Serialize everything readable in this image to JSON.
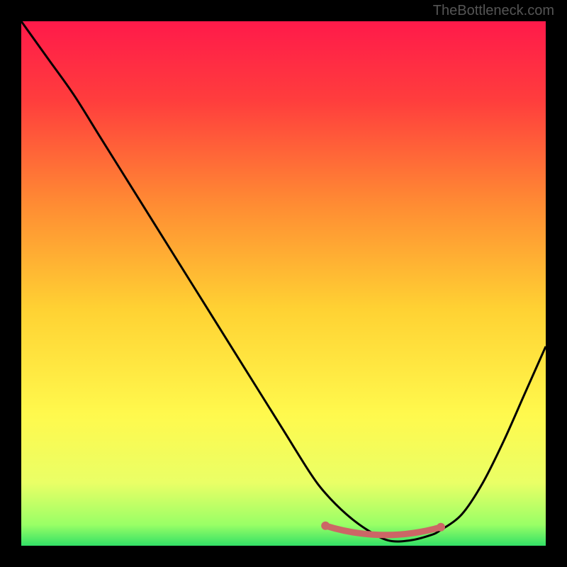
{
  "watermark": "TheBottleneck.com",
  "chart_data": {
    "type": "line",
    "title": "",
    "xlabel": "",
    "ylabel": "",
    "xlim": [
      0,
      100
    ],
    "ylim": [
      0,
      100
    ],
    "background_gradient": {
      "stops": [
        {
          "pos": 0.0,
          "color": "#ff1a4a"
        },
        {
          "pos": 0.15,
          "color": "#ff3d3d"
        },
        {
          "pos": 0.35,
          "color": "#ff8c33"
        },
        {
          "pos": 0.55,
          "color": "#ffd233"
        },
        {
          "pos": 0.75,
          "color": "#fff94d"
        },
        {
          "pos": 0.88,
          "color": "#eaff66"
        },
        {
          "pos": 0.96,
          "color": "#99ff66"
        },
        {
          "pos": 1.0,
          "color": "#33e066"
        }
      ]
    },
    "series": [
      {
        "name": "bottleneck-curve",
        "color": "#000000",
        "x": [
          0,
          5,
          10,
          15,
          20,
          25,
          30,
          35,
          40,
          45,
          50,
          55,
          58,
          62,
          66,
          70,
          74,
          78,
          80,
          84,
          88,
          92,
          96,
          100
        ],
        "y": [
          100,
          93,
          86,
          78,
          70,
          62,
          54,
          46,
          38,
          30,
          22,
          14,
          10,
          6,
          3,
          1,
          1,
          2,
          3,
          6,
          12,
          20,
          29,
          38
        ]
      }
    ],
    "optimal_band": {
      "name": "optimal-range-marker",
      "color": "#cc6666",
      "x_start": 58,
      "x_end": 80,
      "y": 3
    }
  }
}
